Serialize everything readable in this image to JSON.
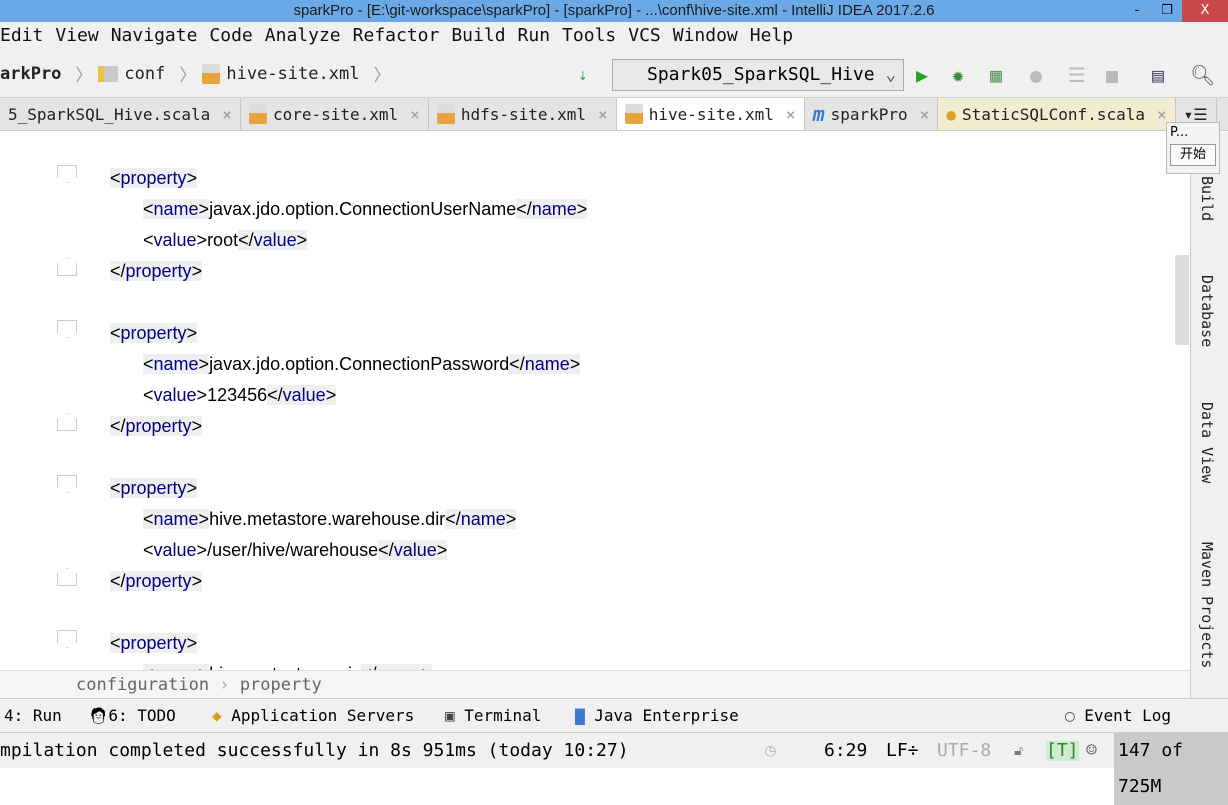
{
  "window": {
    "title": "sparkPro - [E:\\git-workspace\\sparkPro] - [sparkPro] - ...\\conf\\hive-site.xml - IntelliJ IDEA 2017.2.6",
    "minimize": "-",
    "restore": "❐",
    "close": "X"
  },
  "menu": [
    "Edit",
    "View",
    "Navigate",
    "Code",
    "Analyze",
    "Refactor",
    "Build",
    "Run",
    "Tools",
    "VCS",
    "Window",
    "Help"
  ],
  "breadcrumb": [
    "arkPro",
    "conf",
    "hive-site.xml"
  ],
  "toolbar": {
    "run_config": "Spark05_SparkSQL_Hive"
  },
  "tabs": [
    {
      "label": "5_SparkSQL_Hive.scala",
      "active": false
    },
    {
      "label": "core-site.xml",
      "active": false
    },
    {
      "label": "hdfs-site.xml",
      "active": false
    },
    {
      "label": "hive-site.xml",
      "active": true
    },
    {
      "label": "sparkPro",
      "active": false
    },
    {
      "label": "StaticSQLConf.scala",
      "active": false
    }
  ],
  "editor": {
    "blocks": [
      {
        "name": "javax.jdo.option.ConnectionUserName",
        "value": "root"
      },
      {
        "name": "javax.jdo.option.ConnectionPassword",
        "value": "123456"
      },
      {
        "name": "hive.metastore.warehouse.dir",
        "value": "/user/hive/warehouse"
      },
      {
        "name": "hive.metastore.uris",
        "value": ""
      }
    ]
  },
  "popup": {
    "title": "P...",
    "button": "开始"
  },
  "right_tools": [
    "Build",
    "Database",
    "Data View",
    "Maven Projects"
  ],
  "editor_breadcrumb": [
    "configuration",
    "property"
  ],
  "tool_windows": {
    "run": "4: Run",
    "todo": "6: TODO",
    "app_servers": "Application Servers",
    "terminal": "Terminal",
    "java_ee": "Java Enterprise",
    "event_log": "Event Log"
  },
  "status": {
    "message": "mpilation completed successfully in 8s 951ms (today 10:27)",
    "position": "6:29",
    "line_sep": "LF÷",
    "encoding": "UTF-8",
    "tag": "[T]",
    "memory": "147 of 725M"
  }
}
